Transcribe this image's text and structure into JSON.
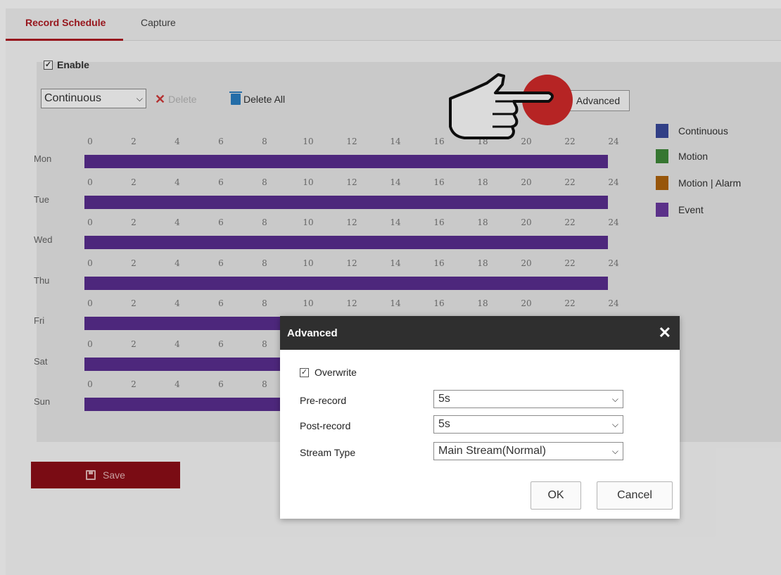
{
  "tabs": [
    {
      "label": "Record Schedule",
      "active": true
    },
    {
      "label": "Capture",
      "active": false
    }
  ],
  "enable": {
    "label": "Enable",
    "checked": true
  },
  "toolbar": {
    "type_select": "Continuous",
    "delete_label": "Delete",
    "delete_all_label": "Delete All",
    "advanced_label": "Advanced"
  },
  "schedule": {
    "tick_labels": [
      "0",
      "2",
      "4",
      "6",
      "8",
      "10",
      "12",
      "14",
      "16",
      "18",
      "20",
      "22",
      "24"
    ],
    "days": [
      {
        "label": "Mon"
      },
      {
        "label": "Tue"
      },
      {
        "label": "Wed"
      },
      {
        "label": "Thu"
      },
      {
        "label": "Fri"
      },
      {
        "label": "Sat"
      },
      {
        "label": "Sun"
      }
    ],
    "bar_type": "Event",
    "bar_color": "#5a2e91"
  },
  "legend": [
    {
      "label": "Continuous",
      "color": "#3a4a9c"
    },
    {
      "label": "Motion",
      "color": "#3f8a3a"
    },
    {
      "label": "Motion | Alarm",
      "color": "#b0650d"
    },
    {
      "label": "Event",
      "color": "#6a3aa0"
    }
  ],
  "save_label": "Save",
  "dialog": {
    "title": "Advanced",
    "close_icon": "close-icon",
    "overwrite": {
      "label": "Overwrite",
      "checked": true
    },
    "pre_record": {
      "label": "Pre-record",
      "value": "5s"
    },
    "post_record": {
      "label": "Post-record",
      "value": "5s"
    },
    "stream_type": {
      "label": "Stream Type",
      "value": "Main Stream(Normal)"
    },
    "ok_label": "OK",
    "cancel_label": "Cancel"
  },
  "colors": {
    "accent": "#b01a22",
    "save_bg": "#8e0e18",
    "dialog_header": "#2f2f2f",
    "pointer_dot": "#d42a2a"
  }
}
